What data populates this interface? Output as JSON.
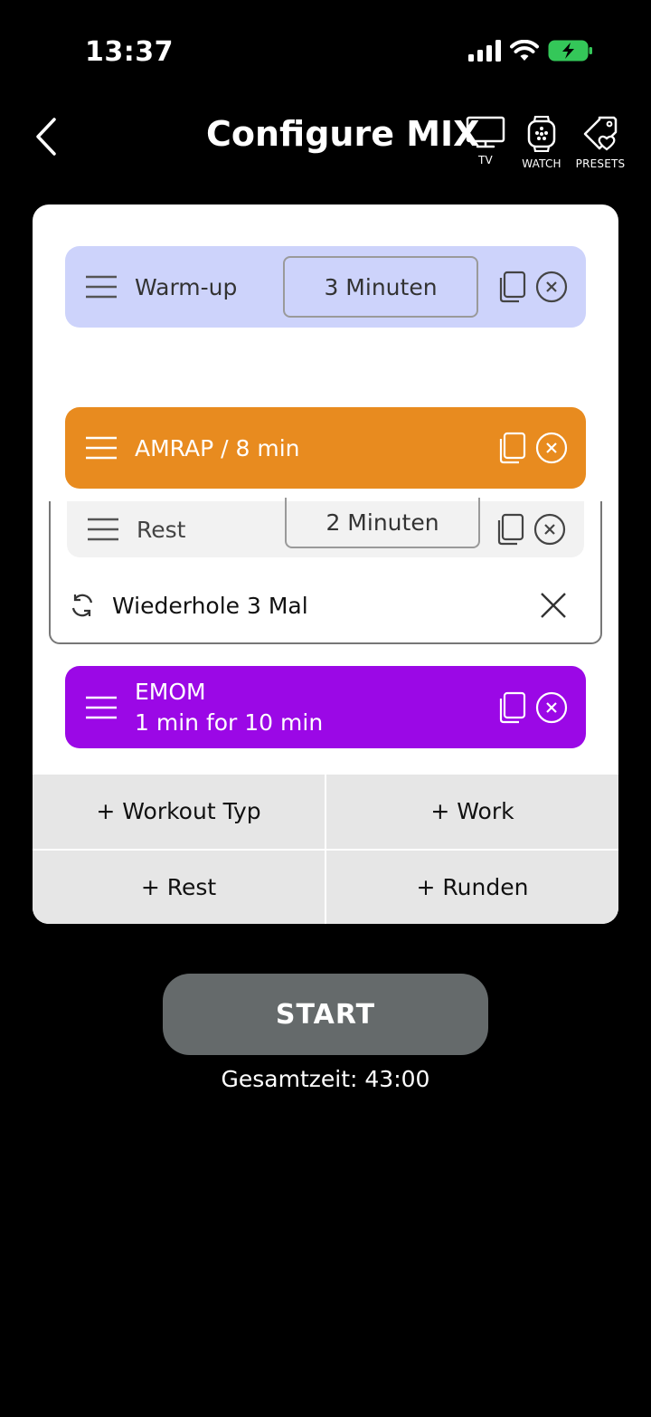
{
  "status": {
    "time": "13:37"
  },
  "header": {
    "title": "Configure MIX",
    "tv_label": "TV",
    "watch_label": "WATCH",
    "presets_label": "PRESETS"
  },
  "blocks": {
    "warmup": {
      "title": "Warm-up",
      "duration": "3 Minuten",
      "color": "#cdd3fb"
    },
    "amrap": {
      "title": "AMRAP / 8 min",
      "color": "#e88b1f"
    },
    "rest": {
      "title": "Rest",
      "duration": "2 Minuten"
    },
    "repeat": {
      "text": "Wiederhole 3 Mal"
    },
    "emom": {
      "title_line1": "EMOM",
      "title_line2": "1 min for 10 min",
      "color": "#9b08e6"
    }
  },
  "add_buttons": {
    "workout_type": "+ Workout Typ",
    "work": "+ Work",
    "rest": "+ Rest",
    "rounds": "+ Runden"
  },
  "start": {
    "label": "START",
    "total": "Gesamtzeit: 43:00"
  },
  "icons": [
    "chevron-left-icon",
    "tv-icon",
    "watch-icon",
    "tag-heart-icon",
    "menu-icon",
    "copy-icon",
    "close-circle-icon",
    "repeat-icon",
    "close-icon",
    "signal-icon",
    "wifi-icon",
    "battery-icon"
  ]
}
